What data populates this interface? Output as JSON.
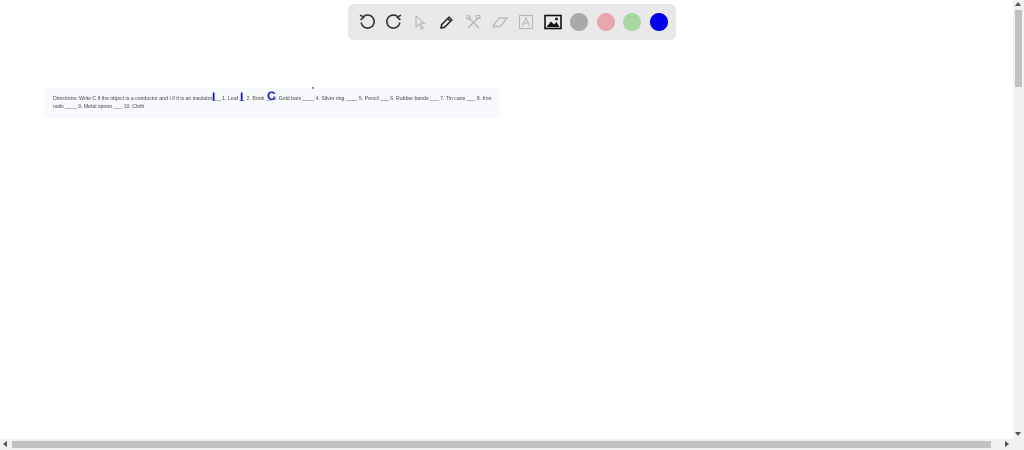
{
  "toolbar": {
    "tools": [
      {
        "name": "undo-icon",
        "state": "active"
      },
      {
        "name": "redo-icon",
        "state": "active"
      },
      {
        "name": "select-pointer-icon",
        "state": "disabled"
      },
      {
        "name": "pen-icon",
        "state": "active"
      },
      {
        "name": "tools-icon",
        "state": "disabled"
      },
      {
        "name": "eraser-icon",
        "state": "disabled"
      },
      {
        "name": "text-icon",
        "state": "disabled"
      },
      {
        "name": "image-icon",
        "state": "active"
      }
    ],
    "colors": [
      "#a9a9a9",
      "#e8a6ad",
      "#a9d6a3",
      "#0000ee"
    ]
  },
  "canvas": {
    "worksheet_line1": "Directions: Write C if the object is a conductor and I if it is an insulator. __ 1. Leaf __ 2. Book __ 3. Gold bars ____ 4. Silver ring ____ 5. Pencil ___ 6. Rubber bands ___ 7. Tin cans ___ 8. Iron",
    "worksheet_line2": "nails ____ 9. Metal spoon ___ 10. Cloth",
    "handwritten": [
      "I",
      "I",
      "C",
      "˙"
    ]
  }
}
